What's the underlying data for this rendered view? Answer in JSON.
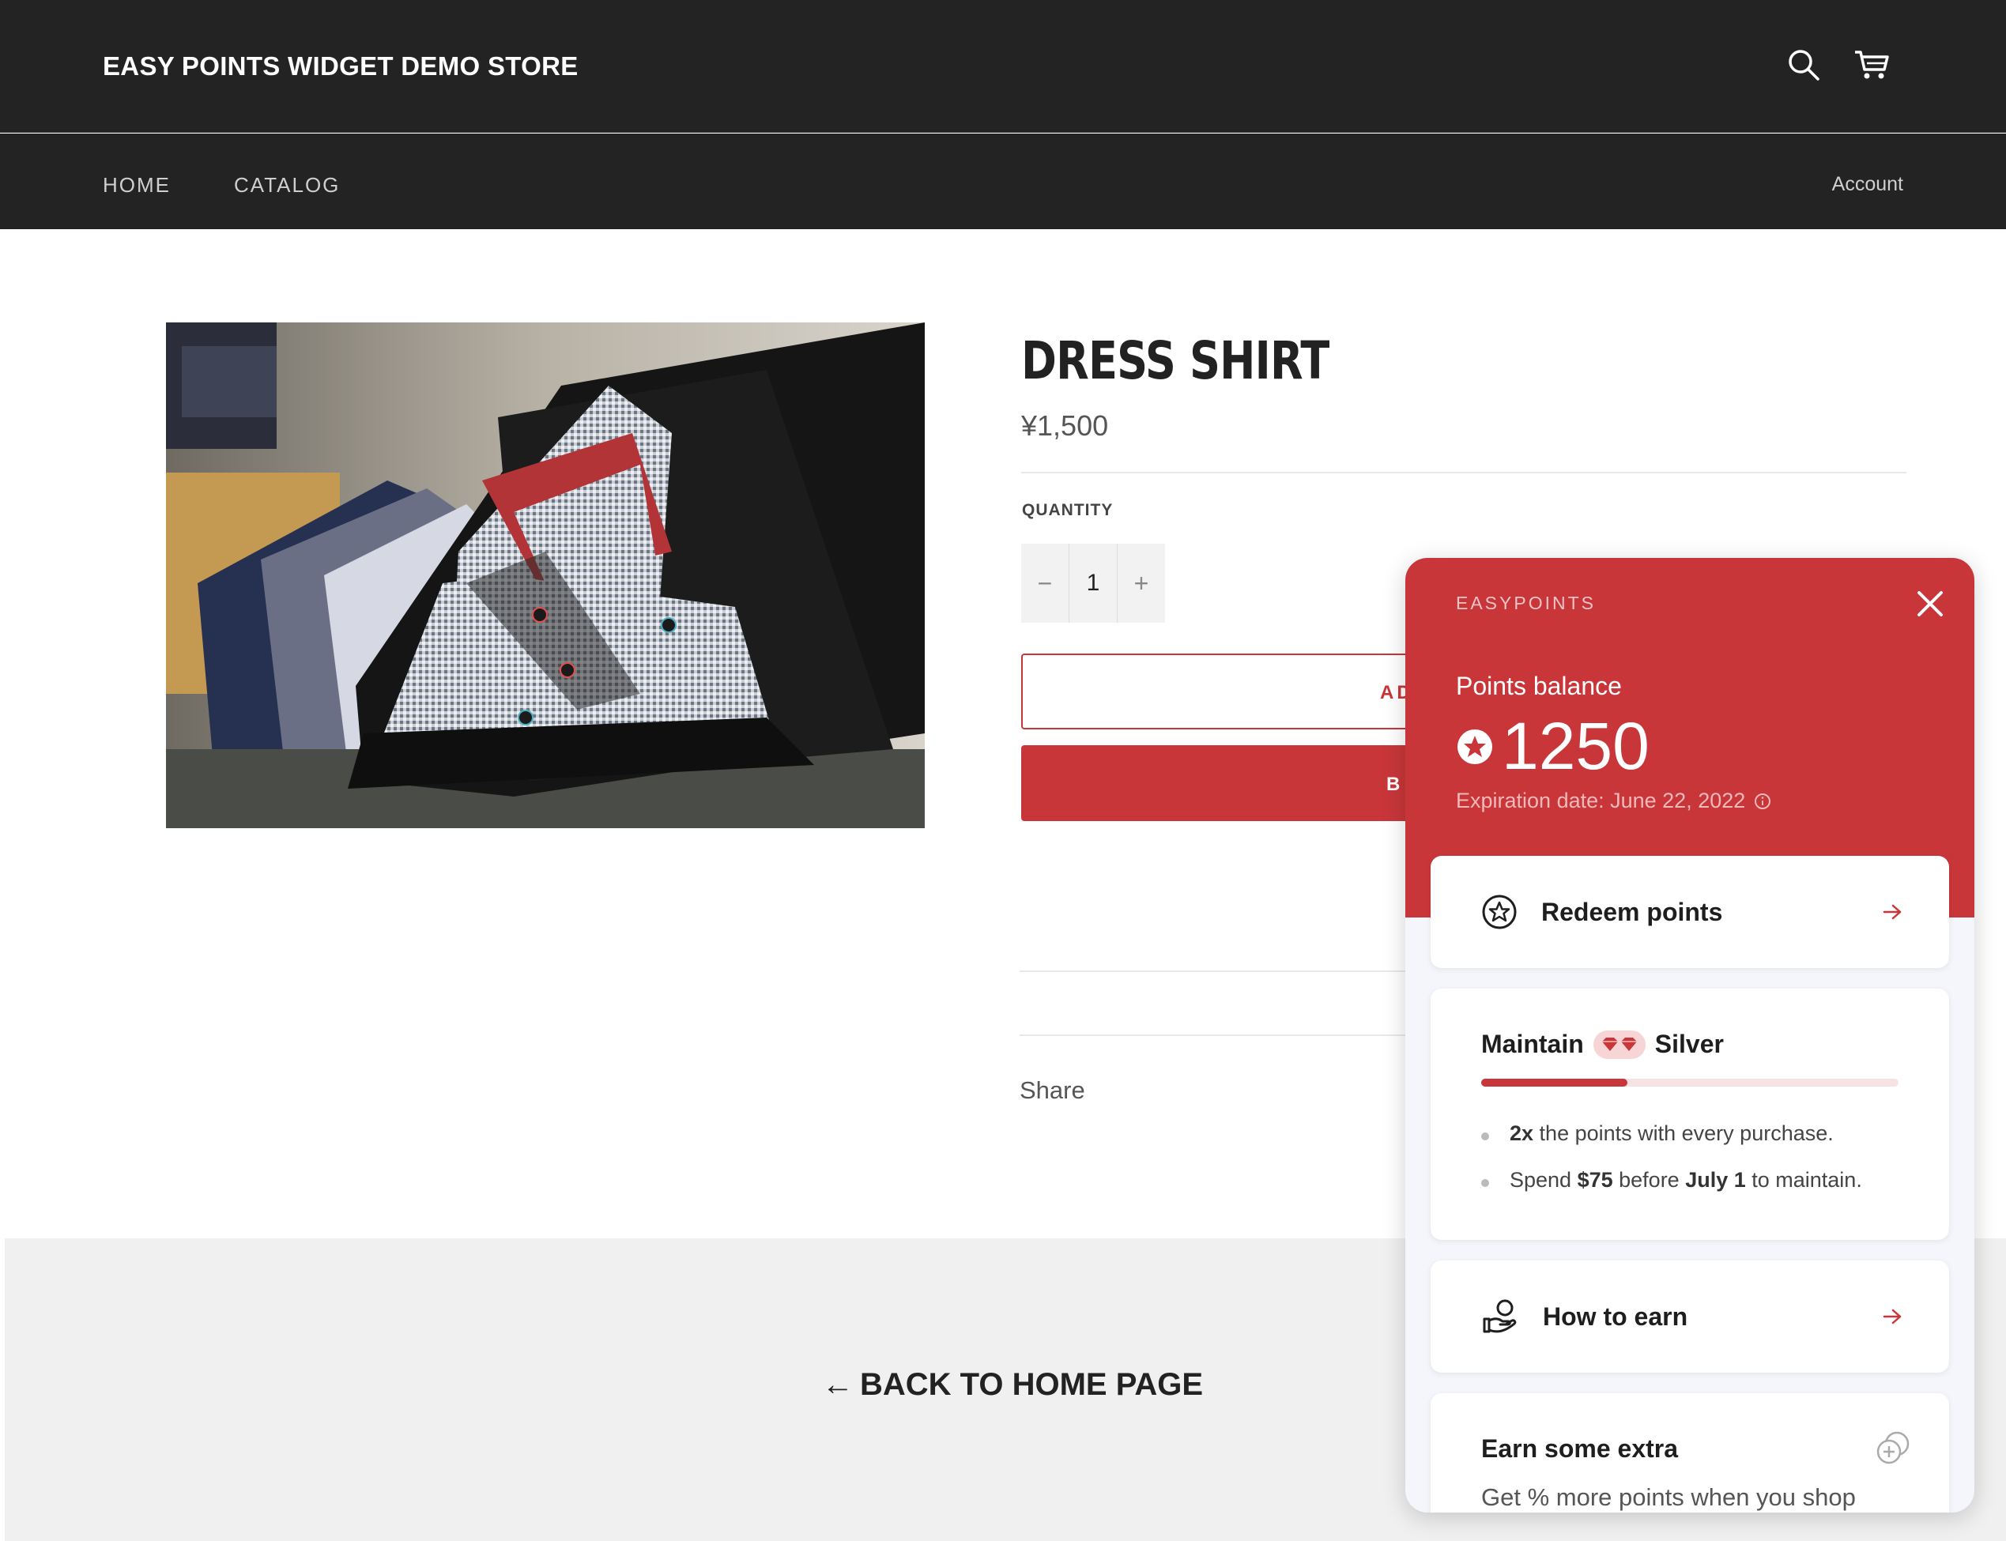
{
  "header": {
    "store_title": "EASY POINTS WIDGET DEMO STORE",
    "icons": [
      "search-icon",
      "cart-icon"
    ]
  },
  "nav": {
    "items": [
      {
        "label": "HOME"
      },
      {
        "label": "CATALOG"
      }
    ],
    "account": "Account"
  },
  "product": {
    "title": "DRESS SHIRT",
    "price": "¥1,500",
    "quantity_label": "QUANTITY",
    "quantity": "1",
    "minus": "−",
    "plus": "+",
    "add_to_cart_visible": "AD",
    "buy_now_visible": "B",
    "share": "Share"
  },
  "footer": {
    "back_link": "BACK TO HOME PAGE",
    "arrow": "←"
  },
  "widget": {
    "brand": "EASYPOINTS",
    "balance_label": "Points balance",
    "balance": "1250",
    "expiry": "Expiration date: June 22, 2022",
    "accent_color": "#c8363a",
    "redeem_label": "Redeem points",
    "tier": {
      "prefix": "Maintain",
      "name": "Silver",
      "progress": 0.35,
      "perk1": {
        "bold": "2x",
        "text": " the points with every purchase."
      },
      "perk2": {
        "pre": "Spend ",
        "amount": "$75",
        "mid": " before ",
        "date": "July 1",
        "post": " to maintain."
      }
    },
    "earn_label": "How to earn",
    "extra": {
      "title": "Earn some extra",
      "subtitle": "Get % more points when you shop"
    }
  }
}
